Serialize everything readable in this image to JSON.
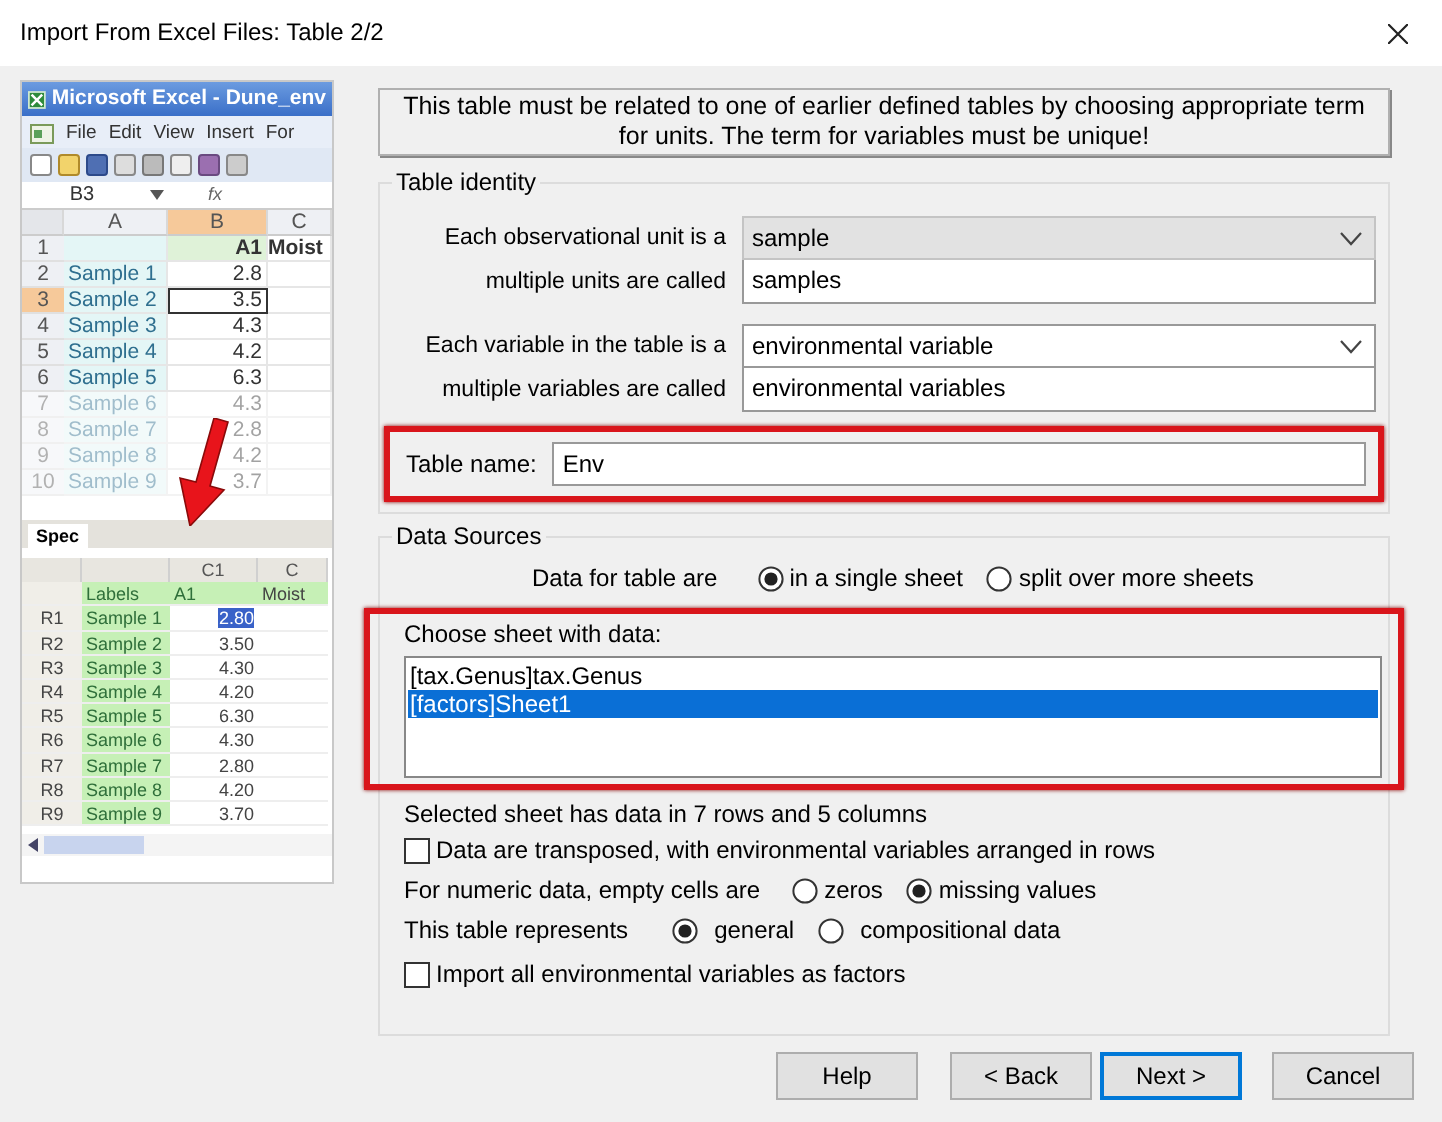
{
  "window": {
    "title": "Import From Excel Files: Table 2/2"
  },
  "excel_preview": {
    "title": "Microsoft Excel - Dune_env",
    "menu": [
      "File",
      "Edit",
      "View",
      "Insert",
      "For"
    ],
    "name_box": "B3",
    "formula_label": "fx",
    "columns": [
      "A",
      "B",
      "C"
    ],
    "rows": [
      {
        "num": "1",
        "label": "",
        "value": "A1",
        "extra": "Moist",
        "faded": false,
        "header": true,
        "selected": false
      },
      {
        "num": "2",
        "label": "Sample 1",
        "value": "2.8",
        "extra": "",
        "faded": false,
        "header": false,
        "selected": false
      },
      {
        "num": "3",
        "label": "Sample 2",
        "value": "3.5",
        "extra": "",
        "faded": false,
        "header": false,
        "selected": true
      },
      {
        "num": "4",
        "label": "Sample 3",
        "value": "4.3",
        "extra": "",
        "faded": false,
        "header": false,
        "selected": false
      },
      {
        "num": "5",
        "label": "Sample 4",
        "value": "4.2",
        "extra": "",
        "faded": false,
        "header": false,
        "selected": false
      },
      {
        "num": "6",
        "label": "Sample 5",
        "value": "6.3",
        "extra": "",
        "faded": false,
        "header": false,
        "selected": false
      },
      {
        "num": "7",
        "label": "Sample 6",
        "value": "4.3",
        "extra": "",
        "faded": true,
        "header": false,
        "selected": false
      },
      {
        "num": "8",
        "label": "Sample 7",
        "value": "2.8",
        "extra": "",
        "faded": true,
        "header": false,
        "selected": false
      },
      {
        "num": "9",
        "label": "Sample 8",
        "value": "4.2",
        "extra": "",
        "faded": true,
        "header": false,
        "selected": false
      },
      {
        "num": "10",
        "label": "Sample 9",
        "value": "3.7",
        "extra": "",
        "faded": true,
        "header": false,
        "selected": false
      }
    ],
    "sheet_tab": "Spec",
    "grid": {
      "columns": [
        "C1",
        "C"
      ],
      "header": [
        "Labels",
        "A1",
        "Moist"
      ],
      "rows": [
        {
          "id": "R1",
          "label": "Sample 1",
          "value": "2.80",
          "selected": true
        },
        {
          "id": "R2",
          "label": "Sample 2",
          "value": "3.50",
          "selected": false
        },
        {
          "id": "R3",
          "label": "Sample 3",
          "value": "4.30",
          "selected": false
        },
        {
          "id": "R4",
          "label": "Sample 4",
          "value": "4.20",
          "selected": false
        },
        {
          "id": "R5",
          "label": "Sample 5",
          "value": "6.30",
          "selected": false
        },
        {
          "id": "R6",
          "label": "Sample 6",
          "value": "4.30",
          "selected": false
        },
        {
          "id": "R7",
          "label": "Sample 7",
          "value": "2.80",
          "selected": false
        },
        {
          "id": "R8",
          "label": "Sample 8",
          "value": "4.20",
          "selected": false
        },
        {
          "id": "R9",
          "label": "Sample 9",
          "value": "3.70",
          "selected": false
        }
      ]
    }
  },
  "notice": "This table must be related to one of earlier defined tables by choosing appropriate term for units. The term for variables must be unique!",
  "table_identity": {
    "title": "Table identity",
    "fields": [
      {
        "label": "Each observational unit is a",
        "value": "sample",
        "kind": "dropdown",
        "disabled": true
      },
      {
        "label": "multiple units are called",
        "value": "samples",
        "kind": "text",
        "disabled": false
      },
      {
        "label": "Each variable in the table is a",
        "value": "environmental variable",
        "kind": "dropdown",
        "disabled": false
      },
      {
        "label": "multiple variables are called",
        "value": "environmental variables",
        "kind": "text",
        "disabled": false
      }
    ],
    "table_name": {
      "label": "Table name:",
      "value": "Env",
      "highlighted": true
    }
  },
  "data_sources": {
    "title": "Data Sources",
    "layout": {
      "label": "Data for table are",
      "options": [
        {
          "label": "in a single sheet",
          "selected": true
        },
        {
          "label": "split over more sheets",
          "selected": false
        }
      ]
    },
    "sheet_list": {
      "label": "Choose sheet with data:",
      "highlighted": true,
      "items": [
        {
          "label": "[tax.Genus]tax.Genus",
          "selected": false
        },
        {
          "label": "[factors]Sheet1",
          "selected": true
        }
      ]
    },
    "info": "Selected sheet has data in 7 rows and 5 columns",
    "transposed": {
      "label": "Data are transposed, with environmental variables arranged in rows",
      "checked": false
    },
    "empty_cells": {
      "label": "For numeric data, empty cells are",
      "options": [
        {
          "label": "zeros",
          "selected": false
        },
        {
          "label": "missing values",
          "selected": true
        }
      ]
    },
    "represents": {
      "label": "This table represents",
      "options": [
        {
          "label": "general",
          "selected": true
        },
        {
          "label": "compositional data",
          "selected": false
        }
      ]
    },
    "factors": {
      "label": "Import all environmental variables as factors",
      "checked": false
    }
  },
  "buttons": [
    {
      "label": "Help",
      "default": false
    },
    {
      "label": "< Back",
      "default": false
    },
    {
      "label": "Next >",
      "default": true
    },
    {
      "label": "Cancel",
      "default": false
    }
  ]
}
